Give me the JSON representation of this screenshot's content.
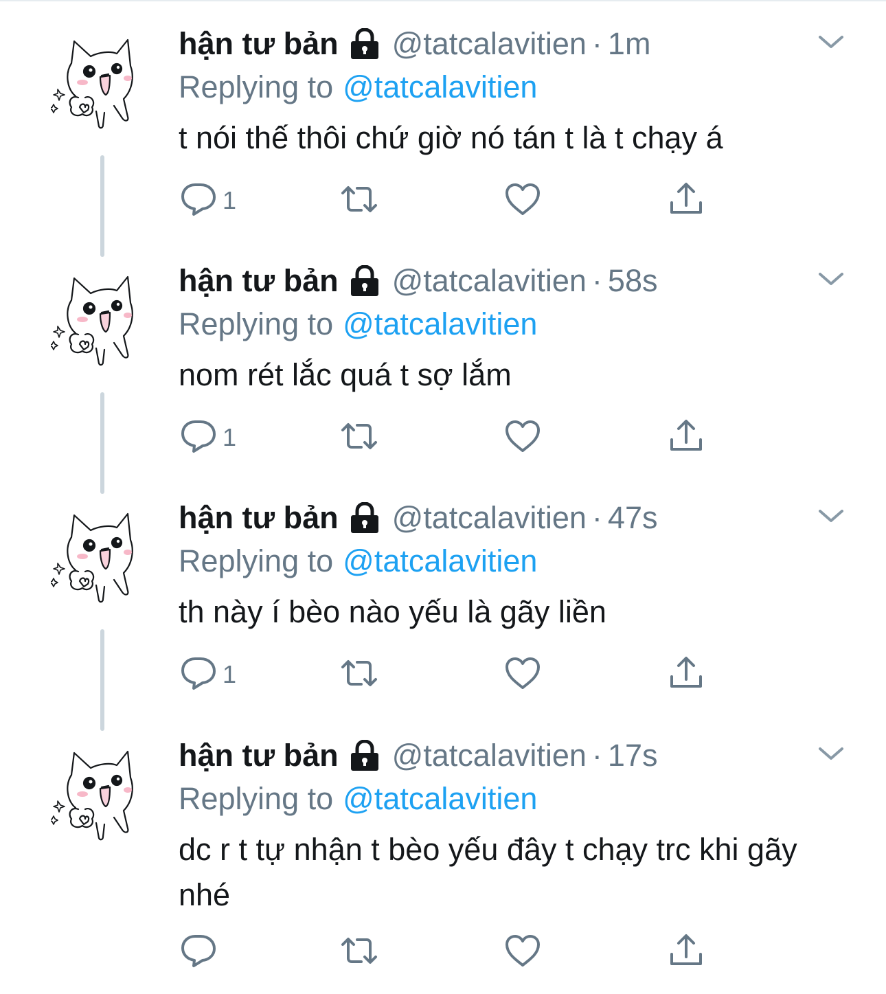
{
  "colors": {
    "accent": "#1da1f2",
    "muted": "#657786",
    "thread_line": "#ccd6dd",
    "text": "#14171a"
  },
  "icons": {
    "reply": "speech-bubble-icon",
    "retweet": "retweet-icon",
    "like": "heart-icon",
    "share": "share-icon",
    "protected": "lock-icon",
    "menu": "chevron-down-icon"
  },
  "tweets": [
    {
      "name": "hận tư bản",
      "handle": "@tatcalavitien",
      "sep": "·",
      "time": "1m",
      "replying_label": "Replying to",
      "replying_to": "@tatcalavitien",
      "text": "t nói thế thôi chứ giờ nó tán t là t chạy á",
      "reply_count": "1"
    },
    {
      "name": "hận tư bản",
      "handle": "@tatcalavitien",
      "sep": "·",
      "time": "58s",
      "replying_label": "Replying to",
      "replying_to": "@tatcalavitien",
      "text": "nom rét lắc quá t sợ lắm",
      "reply_count": "1"
    },
    {
      "name": "hận tư bản",
      "handle": "@tatcalavitien",
      "sep": "·",
      "time": "47s",
      "replying_label": "Replying to",
      "replying_to": "@tatcalavitien",
      "text": "th này í bèo nào yếu là gãy liền",
      "reply_count": "1"
    },
    {
      "name": "hận tư bản",
      "handle": "@tatcalavitien",
      "sep": "·",
      "time": "17s",
      "replying_label": "Replying to",
      "replying_to": "@tatcalavitien",
      "text": "dc r t tự nhận t bèo yếu đây t chạy trc khi gãy nhé",
      "reply_count": ""
    }
  ]
}
